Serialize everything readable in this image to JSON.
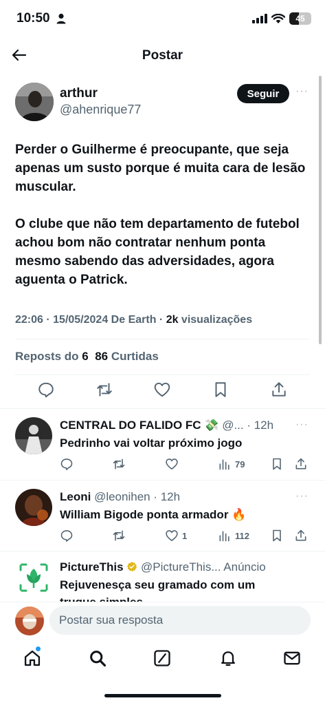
{
  "status_bar": {
    "time": "10:50",
    "battery": "45"
  },
  "topbar": {
    "title": "Postar"
  },
  "author": {
    "name": "arthur",
    "handle": "@ahenrique77",
    "follow_label": "Seguir"
  },
  "post": {
    "paragraph_1": "Perder o Guilherme é preocupante, que seja apenas um susto porque é muita cara de lesão muscular.",
    "paragraph_2": "O clube que não tem departamento de futebol achou bom não contratar nenhum ponta mesmo sabendo das adversidades, agora aguenta o Patrick."
  },
  "meta": {
    "datetime": "22:06 · 15/05/2024 De Earth · ",
    "views_count": "2k",
    "views_label": " visualizações"
  },
  "stats": {
    "reposts_label": "Reposts do ",
    "reposts_count": "6",
    "likes_count": "86",
    "likes_label": " Curtidas"
  },
  "replies": [
    {
      "name": "CENTRAL DO FALIDO FC 💸",
      "handle": " @... · 12h",
      "text": "Pedrinho vai voltar próximo jogo",
      "likes": "",
      "views": "79"
    },
    {
      "name": "Leoni",
      "handle": " @leonihen · 12h",
      "text": "William Bigode ponta armador 🔥",
      "likes": "1",
      "views": "112"
    },
    {
      "name": "PictureThis",
      "handle": " @PictureThis... Anúncio",
      "text": "Rejuvenesça seu gramado com um",
      "text_2": "truque simples"
    }
  ],
  "compose": {
    "placeholder": "Postar sua resposta"
  },
  "colors": {
    "text": "#0f1419",
    "secondary": "#536471",
    "accent": "#1d9bf0",
    "divider": "#eff3f4",
    "brand_green": "#2fb56a"
  },
  "icons": [
    "back-arrow-icon",
    "reply-icon",
    "repost-icon",
    "like-icon",
    "bookmark-icon",
    "share-icon",
    "views-icon",
    "home-icon",
    "search-icon",
    "grok-icon",
    "notifications-icon",
    "messages-icon",
    "verified-icon"
  ]
}
